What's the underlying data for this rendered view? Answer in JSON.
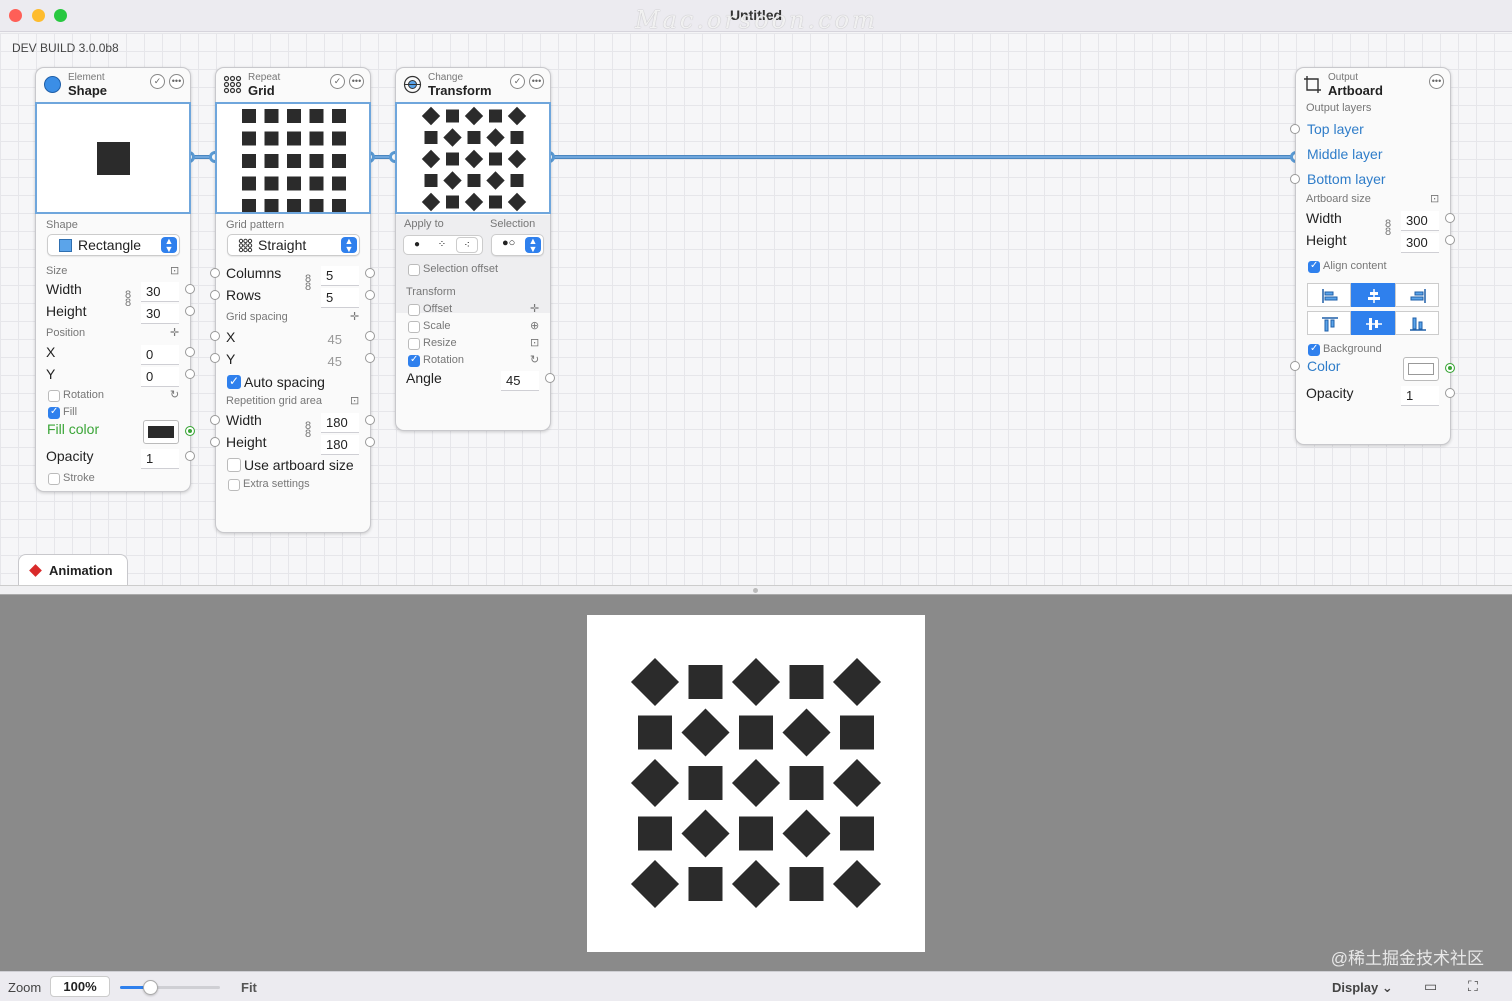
{
  "window": {
    "title": "Untitled",
    "watermark": "Mac.orsoon.com"
  },
  "canvas": {
    "build": "DEV BUILD 3.0.0b8"
  },
  "colors": {
    "accent": "#2f80ed",
    "wire": "#6fa6dc",
    "port_active": "#3aa537",
    "animation_marker": "#d92a2a"
  },
  "shape_node": {
    "category": "Element",
    "name": "Shape",
    "icon": "circle-shape-icon",
    "shape_label": "Shape",
    "shape_value": "Rectangle",
    "size_label": "Size",
    "width_label": "Width",
    "width_value": "30",
    "height_label": "Height",
    "height_value": "30",
    "position_label": "Position",
    "x_label": "X",
    "x_value": "0",
    "y_label": "Y",
    "y_value": "0",
    "rotation_label": "Rotation",
    "fill_label": "Fill",
    "fill_color_label": "Fill color",
    "fill_color": "#2b2b2b",
    "opacity_label": "Opacity",
    "opacity_value": "1",
    "stroke_label": "Stroke"
  },
  "grid_node": {
    "category": "Repeat",
    "name": "Grid",
    "icon": "grid-dots-icon",
    "pattern_label": "Grid pattern",
    "pattern_value": "Straight",
    "columns_label": "Columns",
    "columns_value": "5",
    "rows_label": "Rows",
    "rows_value": "5",
    "spacing_label": "Grid spacing",
    "x_label": "X",
    "x_value": "45",
    "y_label": "Y",
    "y_value": "45",
    "auto_spacing_label": "Auto spacing",
    "area_label": "Repetition grid area",
    "width_label": "Width",
    "width_value": "180",
    "height_label": "Height",
    "height_value": "180",
    "use_artboard_label": "Use artboard size",
    "extra_label": "Extra settings"
  },
  "transform_node": {
    "category": "Change",
    "name": "Transform",
    "icon": "transform-globe-icon",
    "apply_to_label": "Apply to",
    "selection_label": "Selection",
    "selection_offset_label": "Selection offset",
    "transform_label": "Transform",
    "offset_label": "Offset",
    "scale_label": "Scale",
    "resize_label": "Resize",
    "rotation_label": "Rotation",
    "angle_label": "Angle",
    "angle_value": "45"
  },
  "artboard_node": {
    "category": "Output",
    "name": "Artboard",
    "icon": "artboard-crop-icon",
    "output_layers_label": "Output layers",
    "layers": [
      "Top layer",
      "Middle layer",
      "Bottom layer"
    ],
    "size_label": "Artboard size",
    "width_label": "Width",
    "width_value": "300",
    "height_label": "Height",
    "height_value": "300",
    "align_label": "Align content",
    "background_label": "Background",
    "color_label": "Color",
    "opacity_label": "Opacity",
    "opacity_value": "1"
  },
  "animation_tab": {
    "label": "Animation"
  },
  "viewer": {
    "watermark": "@稀土掘金技术社区"
  },
  "statusbar": {
    "zoom_label": "Zoom",
    "zoom_value": "100%",
    "zoom_fraction": 0.3,
    "fit_label": "Fit",
    "display_label": "Display"
  }
}
